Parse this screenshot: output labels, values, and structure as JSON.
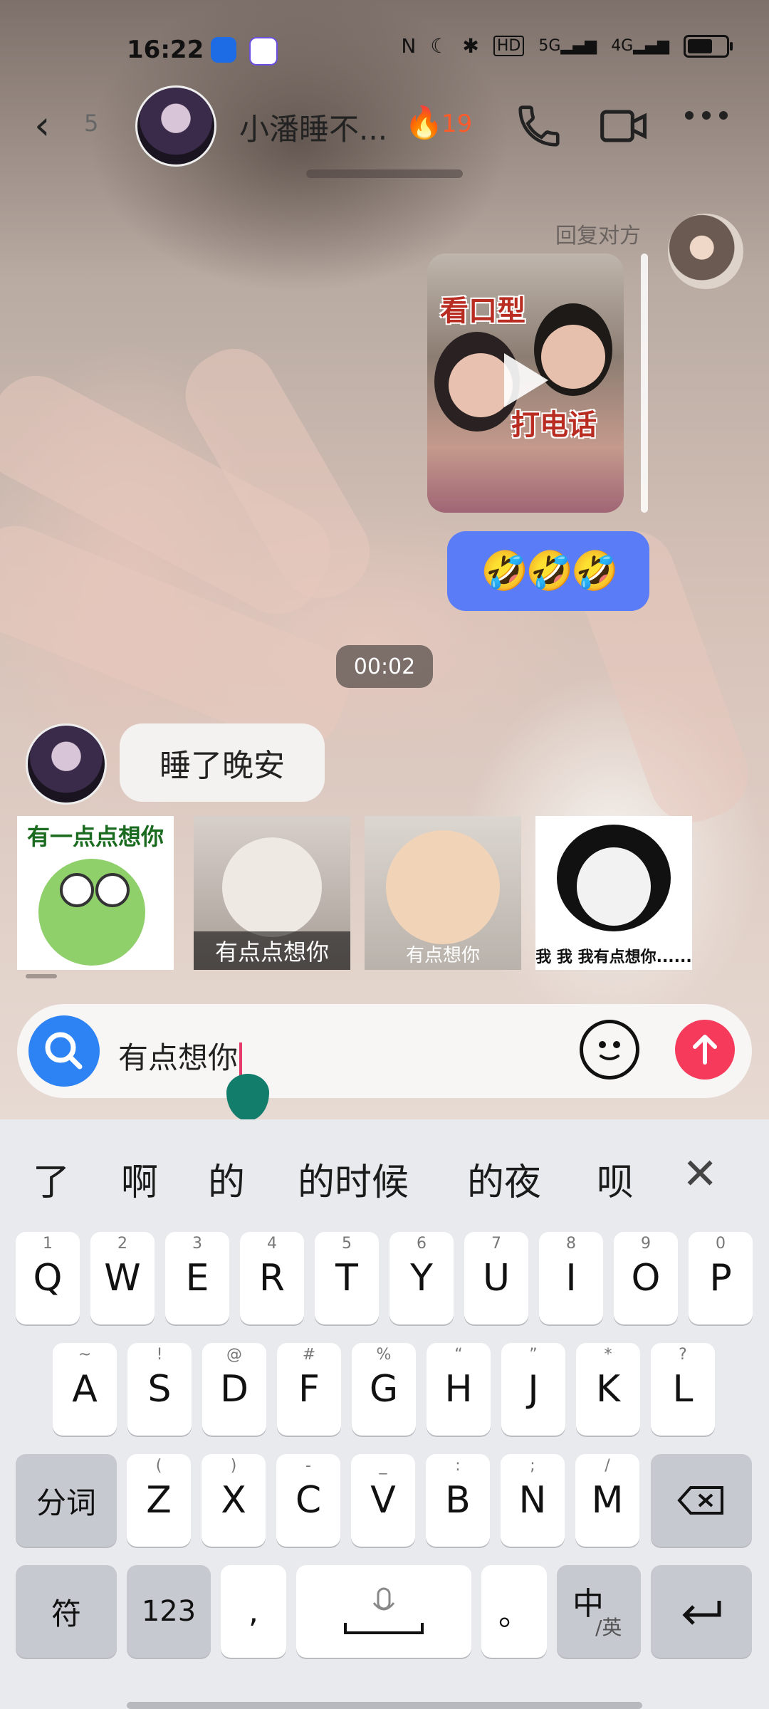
{
  "status_bar": {
    "time": "16:22",
    "network": "5G",
    "network2": "4G"
  },
  "header": {
    "unread_count": "5",
    "contact_name": "小潘睡不...",
    "streak": "19"
  },
  "messages": {
    "reply_label": "回复对方",
    "video_caption_top": "看口型",
    "video_caption_bottom": "打电话",
    "emoji_message": "🤣🤣🤣",
    "timestamp": "00:02",
    "incoming_text": "睡了晚安"
  },
  "stickers": [
    {
      "label": "有一点点想你"
    },
    {
      "label": "有点点想你"
    },
    {
      "label": "有点想你"
    },
    {
      "label": "我 我 我有点想你......"
    }
  ],
  "input": {
    "value": "有点想你"
  },
  "keyboard": {
    "candidates": [
      "了",
      "啊",
      "的",
      "的时候",
      "的夜",
      "呗"
    ],
    "row1": [
      {
        "k": "Q",
        "h": "1"
      },
      {
        "k": "W",
        "h": "2"
      },
      {
        "k": "E",
        "h": "3"
      },
      {
        "k": "R",
        "h": "4"
      },
      {
        "k": "T",
        "h": "5"
      },
      {
        "k": "Y",
        "h": "6"
      },
      {
        "k": "U",
        "h": "7"
      },
      {
        "k": "I",
        "h": "8"
      },
      {
        "k": "O",
        "h": "9"
      },
      {
        "k": "P",
        "h": "0"
      }
    ],
    "row2": [
      {
        "k": "A",
        "h": "~"
      },
      {
        "k": "S",
        "h": "!"
      },
      {
        "k": "D",
        "h": "@"
      },
      {
        "k": "F",
        "h": "#"
      },
      {
        "k": "G",
        "h": "%"
      },
      {
        "k": "H",
        "h": "“"
      },
      {
        "k": "J",
        "h": "”"
      },
      {
        "k": "K",
        "h": "*"
      },
      {
        "k": "L",
        "h": "?"
      }
    ],
    "row3": [
      {
        "k": "Z",
        "h": "("
      },
      {
        "k": "X",
        "h": ")"
      },
      {
        "k": "C",
        "h": "-"
      },
      {
        "k": "V",
        "h": "_"
      },
      {
        "k": "B",
        "h": ":"
      },
      {
        "k": "N",
        "h": ";"
      },
      {
        "k": "M",
        "h": "/"
      }
    ],
    "segment_label": "分词",
    "symbol_label": "符",
    "numbers_label": "123",
    "comma_label": ",",
    "period_label": "。",
    "lang_main": "中",
    "lang_sub": "/英"
  },
  "colors": {
    "accent_blue": "#2d83f4",
    "send_red": "#f53a5c",
    "bubble_blue": "#5b7cf7"
  }
}
